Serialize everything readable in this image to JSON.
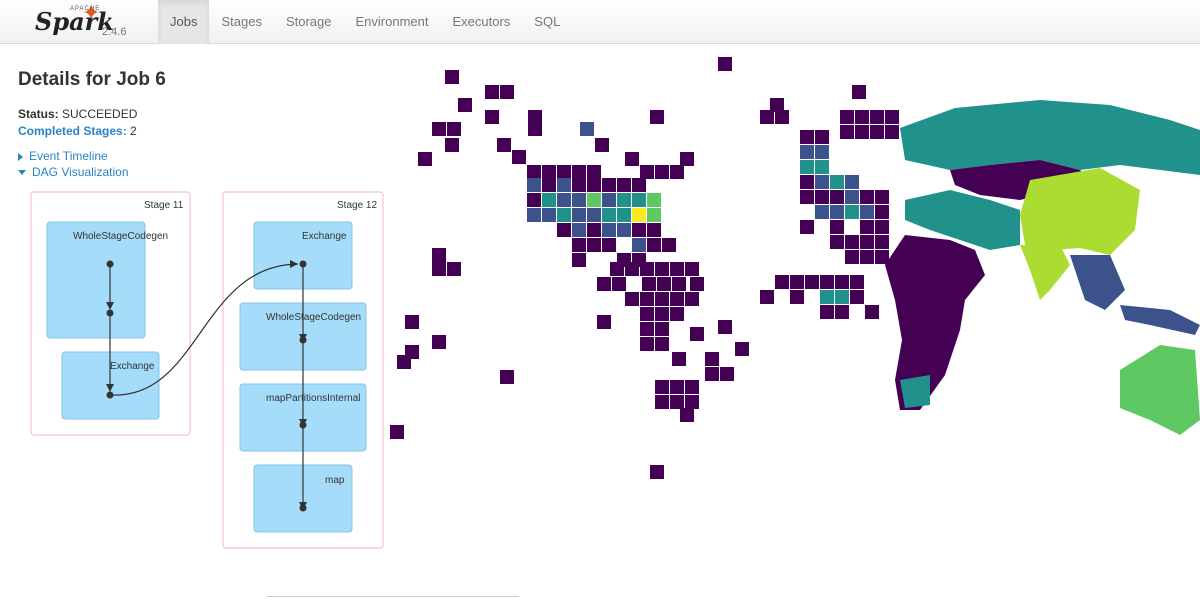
{
  "brand": {
    "apache": "APACHE",
    "name": "Spark",
    "version": "2.4.6"
  },
  "nav": {
    "tabs": [
      "Jobs",
      "Stages",
      "Storage",
      "Environment",
      "Executors",
      "SQL"
    ],
    "active": "Jobs"
  },
  "page": {
    "title": "Details for Job 6",
    "status_label": "Status:",
    "status_value": "SUCCEEDED",
    "stages_label": "Completed Stages:",
    "stages_value": "2",
    "event_timeline": "Event Timeline",
    "dag_visualization": "DAG Visualization"
  },
  "dag": {
    "stages": [
      {
        "label": "Stage 11",
        "ops": [
          "WholeStageCodegen",
          "Exchange"
        ]
      },
      {
        "label": "Stage 12",
        "ops": [
          "Exchange",
          "WholeStageCodegen",
          "mapPartitionsInternal",
          "map"
        ]
      }
    ]
  },
  "map": {
    "colormap": [
      "#440154",
      "#3b528b",
      "#21918c",
      "#5ec962",
      "#aadc32",
      "#fde725"
    ]
  }
}
